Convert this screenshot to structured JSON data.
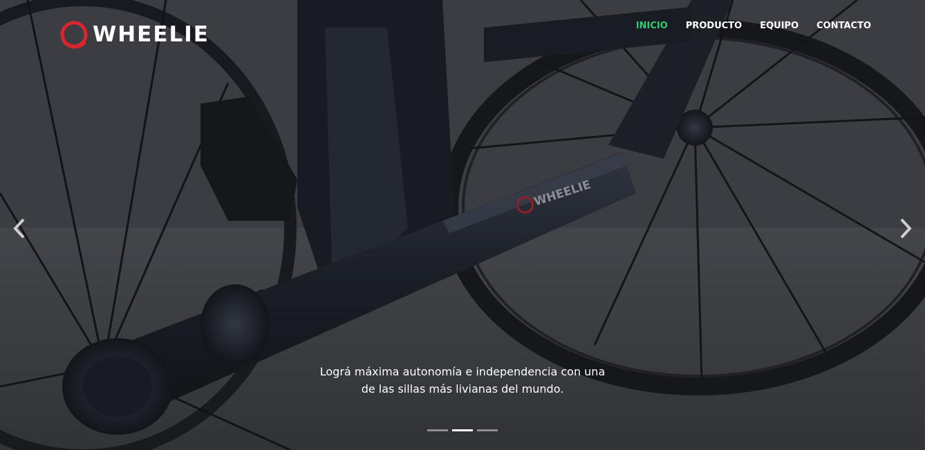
{
  "brand": {
    "name": "WHEELIE",
    "logo_icon": "red-ring-logo-icon",
    "accent_color": "#d7262e"
  },
  "nav": {
    "items": [
      {
        "label": "INICIO",
        "active": true
      },
      {
        "label": "PRODUCTO",
        "active": false
      },
      {
        "label": "EQUIPO",
        "active": false
      },
      {
        "label": "CONTACTO",
        "active": false
      }
    ],
    "active_color": "#2ecc71"
  },
  "carousel": {
    "caption_line1": "Lográ máxima autonomía e independencia con una",
    "caption_line2": "de las sillas más livianas del mundo.",
    "prev_icon": "chevron-left-icon",
    "next_icon": "chevron-right-icon",
    "slide_count": 3,
    "active_slide": 2
  },
  "photo": {
    "frame_text": "WHEELIE"
  }
}
